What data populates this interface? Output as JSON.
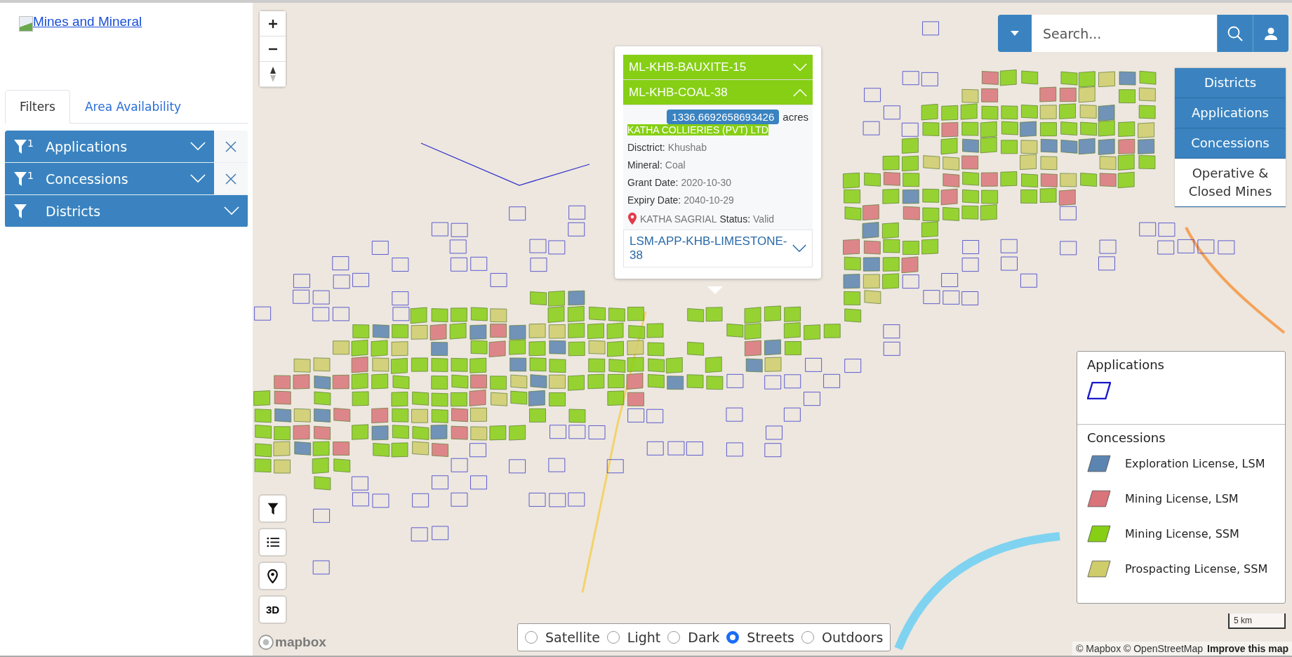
{
  "header": {
    "logo_link": "Mines and Mineral"
  },
  "tabs": [
    {
      "label": "Filters",
      "selected": true
    },
    {
      "label": "Area Availability",
      "selected": false
    }
  ],
  "filters": [
    {
      "label": "Applications",
      "count": "1",
      "clearable": true
    },
    {
      "label": "Concessions",
      "count": "1",
      "clearable": true
    },
    {
      "label": "Districts",
      "clearable": false
    }
  ],
  "map_controls": {
    "three_d": "3D"
  },
  "popup": {
    "items": [
      {
        "kind": "concession",
        "title": "ML-KHB-BAUXITE-15",
        "expanded": false
      },
      {
        "kind": "concession",
        "title": "ML-KHB-COAL-38",
        "expanded": true,
        "area": "1336.6692658693426",
        "area_unit": "acres",
        "company": "KATHA COLLIERIES (PVT) LTD",
        "fields": [
          {
            "label": "Disctrict:",
            "value": "Khushab"
          },
          {
            "label": "Mineral:",
            "value": "Coal"
          },
          {
            "label": "Grant Date:",
            "value": "2020-10-30"
          },
          {
            "label": "Expiry Date:",
            "value": "2040-10-29"
          }
        ],
        "location": "KATHA SAGRIAL",
        "status_label": "Status:",
        "status": "Valid"
      },
      {
        "kind": "application",
        "title": "LSM-APP-KHB-LIMESTONE-38",
        "expanded": false
      }
    ]
  },
  "search": {
    "placeholder": "Search..."
  },
  "layer_buttons": [
    {
      "label": "Districts",
      "active": true
    },
    {
      "label": "Applications",
      "active": true
    },
    {
      "label": "Concessions",
      "active": true
    },
    {
      "label": "Operative & Closed Mines",
      "active": false
    }
  ],
  "legend": {
    "sections": [
      {
        "title": "Applications",
        "items": [
          {
            "kind": "outline",
            "color": "#1a1acc"
          }
        ]
      },
      {
        "title": "Concessions",
        "items": [
          {
            "kind": "fill",
            "color": "#5b84b1",
            "label": "Exploration License, LSM"
          },
          {
            "kind": "fill",
            "color": "#d9747a",
            "label": "Mining License, LSM"
          },
          {
            "kind": "fill",
            "color": "#86cf14",
            "label": "Mining License, SSM"
          },
          {
            "kind": "fill",
            "color": "#cfcc6b",
            "label": "Prospacting License, SSM"
          }
        ]
      }
    ]
  },
  "base_styles": [
    {
      "label": "Satellite",
      "selected": false
    },
    {
      "label": "Light",
      "selected": false
    },
    {
      "label": "Dark",
      "selected": false
    },
    {
      "label": "Streets",
      "selected": true
    },
    {
      "label": "Outdoors",
      "selected": false
    }
  ],
  "scale": "5 km",
  "mapbox_logo": "mapbox",
  "attribution": {
    "text": "© Mapbox © OpenStreetMap",
    "link": "Improve this map"
  }
}
